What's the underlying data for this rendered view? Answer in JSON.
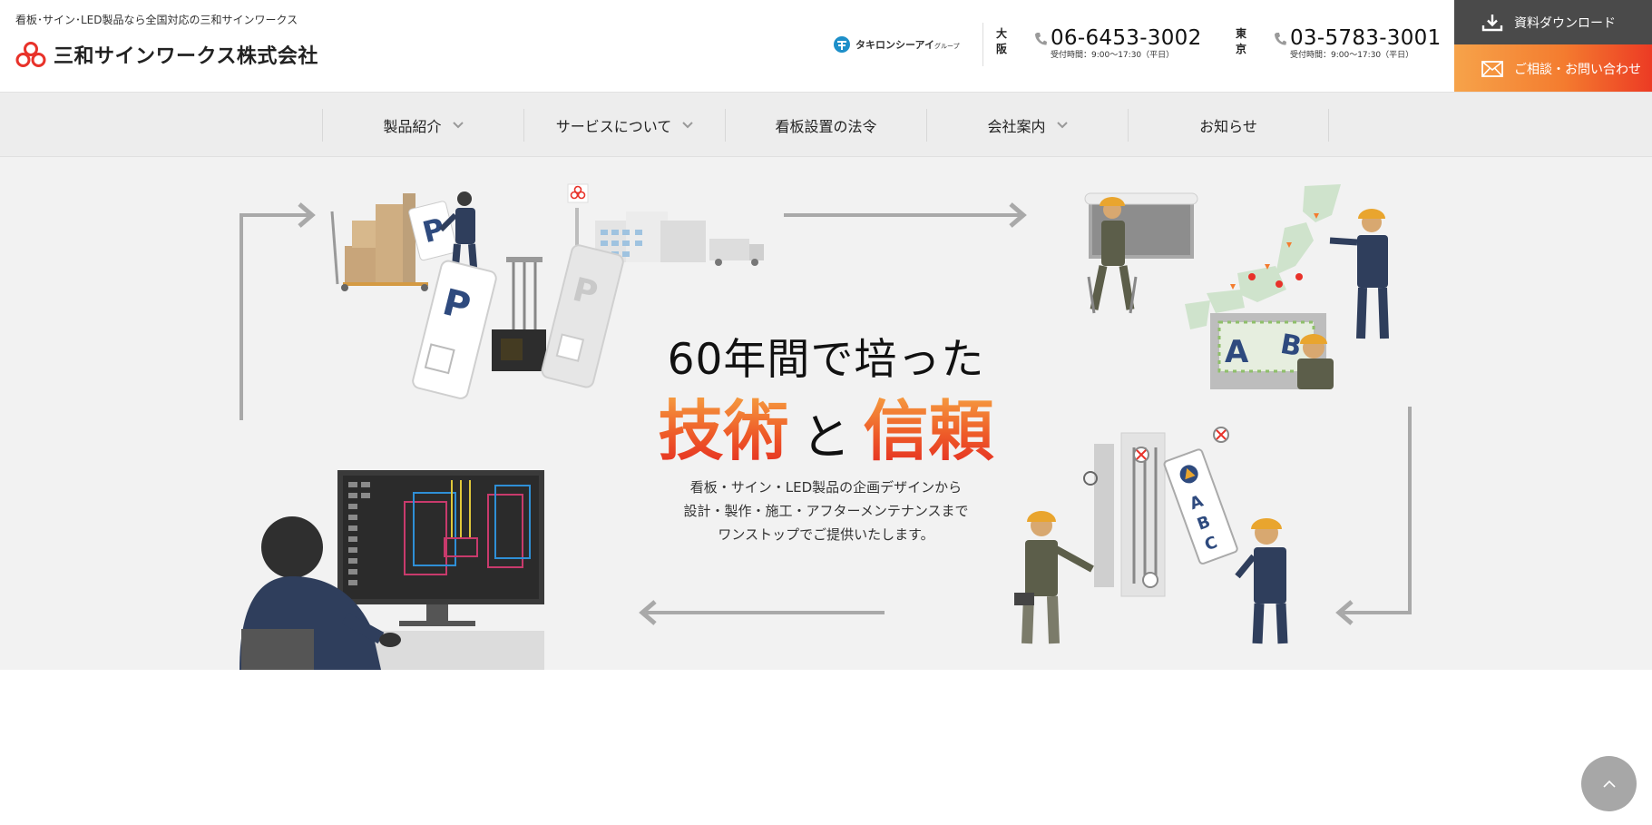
{
  "header": {
    "tagline": "看板･サイン･LED製品なら全国対応の三和サインワークス",
    "company_name": "三和サインワークス株式会社",
    "group_name": "タキロンシーアイ",
    "group_suffix": "グループ",
    "offices": [
      {
        "city": "大阪",
        "phone": "06-6453-3002",
        "hours": "受付時間：9:00〜17:30（平日）"
      },
      {
        "city": "東京",
        "phone": "03-5783-3001",
        "hours": "受付時間：9:00〜17:30（平日）"
      }
    ],
    "download_label": "資料ダウンロード",
    "contact_label": "ご相談・お問い合わせ"
  },
  "nav": {
    "items": [
      {
        "label": "製品紹介",
        "has_dropdown": true
      },
      {
        "label": "サービスについて",
        "has_dropdown": true
      },
      {
        "label": "看板設置の法令",
        "has_dropdown": false
      },
      {
        "label": "会社案内",
        "has_dropdown": true
      },
      {
        "label": "お知らせ",
        "has_dropdown": false
      }
    ]
  },
  "hero": {
    "line1": "60年間で培った",
    "word1": "技術",
    "connector": "と",
    "word2": "信頼",
    "description": [
      "看板・サイン・LED製品の企画デザインから",
      "設計・製作・施工・アフターメンテナンスまで",
      "ワンストップでご提供いたします。"
    ]
  },
  "colors": {
    "brand_red": "#e8322a",
    "accent_orange": "#f47c2f",
    "download_bg": "#4a4a4a",
    "nav_bg": "#ededed",
    "hero_bg": "#f2f2f2",
    "pagetop_bg": "#a7a7a7",
    "worker_navy": "#2f3e5c",
    "helmet_orange": "#e9a52e"
  },
  "icons": {
    "logo": "sanwa-logo-icon",
    "group": "takiron-ci-logo-icon",
    "phone": "phone-icon",
    "download": "download-icon",
    "mail": "mail-icon",
    "chevron": "chevron-down-icon",
    "pagetop": "chevron-up-icon"
  }
}
